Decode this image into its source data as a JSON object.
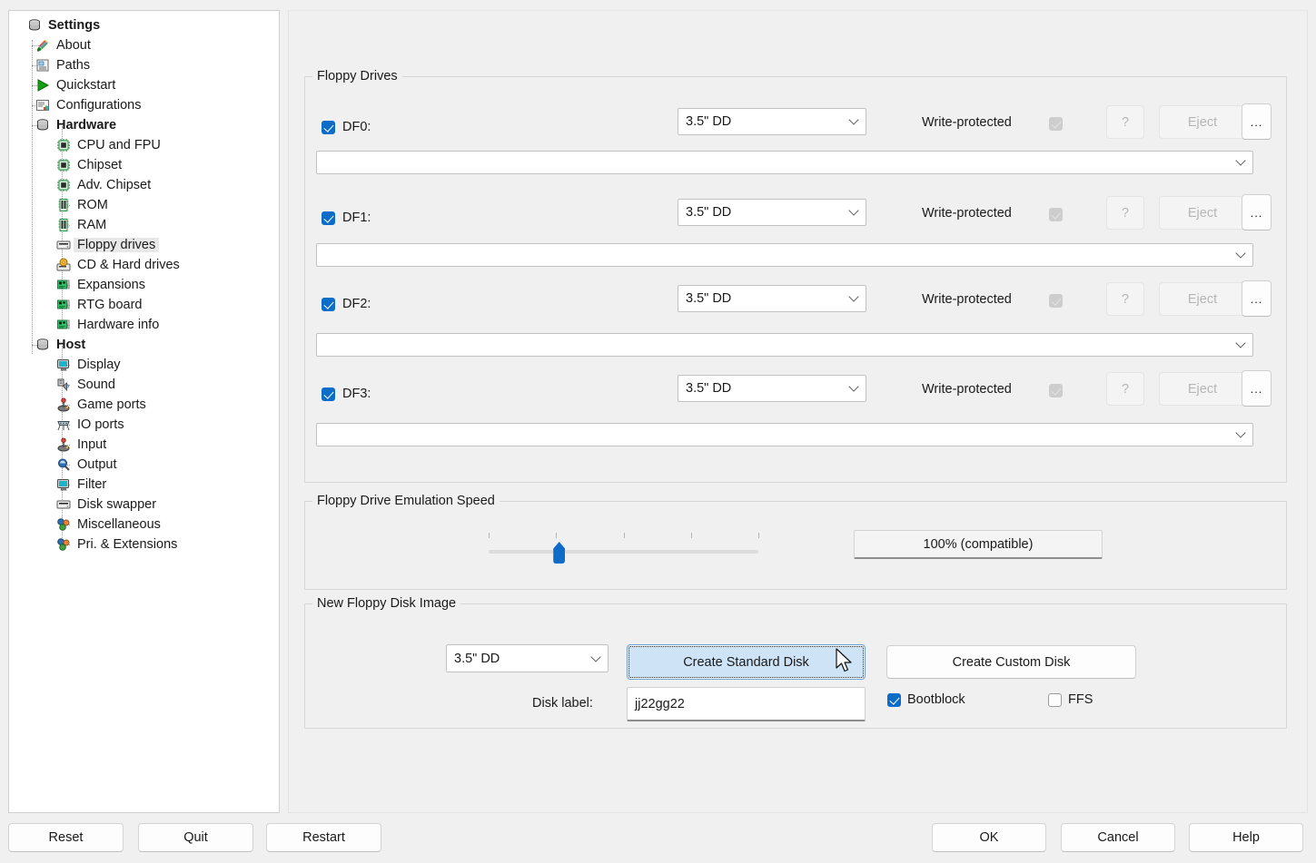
{
  "window": {
    "background": "#f0f0f0",
    "accent": "#0d6cc8"
  },
  "sidebar": {
    "root_label": "Settings",
    "items": [
      {
        "label": "Settings",
        "level": 0,
        "bold": true,
        "selected": false,
        "icon": "settings-stack-icon"
      },
      {
        "label": "About",
        "level": 1,
        "bold": false,
        "selected": false,
        "icon": "about-pencil-icon"
      },
      {
        "label": "Paths",
        "level": 1,
        "bold": false,
        "selected": false,
        "icon": "paths-icon"
      },
      {
        "label": "Quickstart",
        "level": 1,
        "bold": false,
        "selected": false,
        "icon": "quickstart-play-icon"
      },
      {
        "label": "Configurations",
        "level": 1,
        "bold": false,
        "selected": false,
        "icon": "configurations-icon"
      },
      {
        "label": "Hardware",
        "level": 1,
        "bold": true,
        "selected": false,
        "icon": "hardware-stack-icon"
      },
      {
        "label": "CPU and FPU",
        "level": 2,
        "bold": false,
        "selected": false,
        "icon": "chip-icon"
      },
      {
        "label": "Chipset",
        "level": 2,
        "bold": false,
        "selected": false,
        "icon": "chip-icon"
      },
      {
        "label": "Adv. Chipset",
        "level": 2,
        "bold": false,
        "selected": false,
        "icon": "chip-icon"
      },
      {
        "label": "ROM",
        "level": 2,
        "bold": false,
        "selected": false,
        "icon": "memory-stick-icon"
      },
      {
        "label": "RAM",
        "level": 2,
        "bold": false,
        "selected": false,
        "icon": "memory-stick-icon"
      },
      {
        "label": "Floppy drives",
        "level": 2,
        "bold": false,
        "selected": true,
        "icon": "floppy-drive-icon"
      },
      {
        "label": "CD & Hard drives",
        "level": 2,
        "bold": false,
        "selected": false,
        "icon": "cd-hard-drive-icon"
      },
      {
        "label": "Expansions",
        "level": 2,
        "bold": false,
        "selected": false,
        "icon": "expansion-card-icon"
      },
      {
        "label": "RTG board",
        "level": 2,
        "bold": false,
        "selected": false,
        "icon": "expansion-card-icon"
      },
      {
        "label": "Hardware info",
        "level": 2,
        "bold": false,
        "selected": false,
        "icon": "expansion-card-icon"
      },
      {
        "label": "Host",
        "level": 1,
        "bold": true,
        "selected": false,
        "icon": "host-stack-icon"
      },
      {
        "label": "Display",
        "level": 2,
        "bold": false,
        "selected": false,
        "icon": "monitor-icon"
      },
      {
        "label": "Sound",
        "level": 2,
        "bold": false,
        "selected": false,
        "icon": "sound-icon"
      },
      {
        "label": "Game ports",
        "level": 2,
        "bold": false,
        "selected": false,
        "icon": "joystick-icon"
      },
      {
        "label": "IO ports",
        "level": 2,
        "bold": false,
        "selected": false,
        "icon": "io-ports-icon"
      },
      {
        "label": "Input",
        "level": 2,
        "bold": false,
        "selected": false,
        "icon": "joystick-icon"
      },
      {
        "label": "Output",
        "level": 2,
        "bold": false,
        "selected": false,
        "icon": "output-icon"
      },
      {
        "label": "Filter",
        "level": 2,
        "bold": false,
        "selected": false,
        "icon": "monitor-icon"
      },
      {
        "label": "Disk swapper",
        "level": 2,
        "bold": false,
        "selected": false,
        "icon": "floppy-drive-icon"
      },
      {
        "label": "Miscellaneous",
        "level": 2,
        "bold": false,
        "selected": false,
        "icon": "spheres-icon"
      },
      {
        "label": "Pri. & Extensions",
        "level": 2,
        "bold": false,
        "selected": false,
        "icon": "spheres-icon"
      }
    ]
  },
  "floppy_drives": {
    "group_title": "Floppy Drives",
    "write_protected_label": "Write-protected",
    "help_button_label": "?",
    "eject_button_label": "Eject",
    "browse_button_label": "...",
    "drives": [
      {
        "name": "DF0:",
        "enabled": true,
        "type": "3.5\" DD",
        "write_protected": true,
        "path": ""
      },
      {
        "name": "DF1:",
        "enabled": true,
        "type": "3.5\" DD",
        "write_protected": true,
        "path": ""
      },
      {
        "name": "DF2:",
        "enabled": true,
        "type": "3.5\" DD",
        "write_protected": true,
        "path": ""
      },
      {
        "name": "DF3:",
        "enabled": true,
        "type": "3.5\" DD",
        "write_protected": true,
        "path": ""
      }
    ]
  },
  "emulation_speed": {
    "group_title": "Floppy Drive Emulation Speed",
    "readout": "100% (compatible)",
    "slider_position_percent": 26,
    "tick_count": 5
  },
  "new_disk": {
    "group_title": "New Floppy Disk Image",
    "type_value": "3.5\" DD",
    "create_standard_label": "Create Standard Disk",
    "create_custom_label": "Create Custom Disk",
    "disk_label_caption": "Disk label:",
    "disk_label_value": "jj22gg22",
    "bootblock_label": "Bootblock",
    "bootblock_checked": true,
    "ffs_label": "FFS",
    "ffs_checked": false
  },
  "bottom_bar": {
    "left_buttons": [
      {
        "label": "Reset"
      },
      {
        "label": "Quit"
      },
      {
        "label": "Restart"
      }
    ],
    "right_buttons": [
      {
        "label": "OK"
      },
      {
        "label": "Cancel"
      },
      {
        "label": "Help"
      }
    ]
  }
}
